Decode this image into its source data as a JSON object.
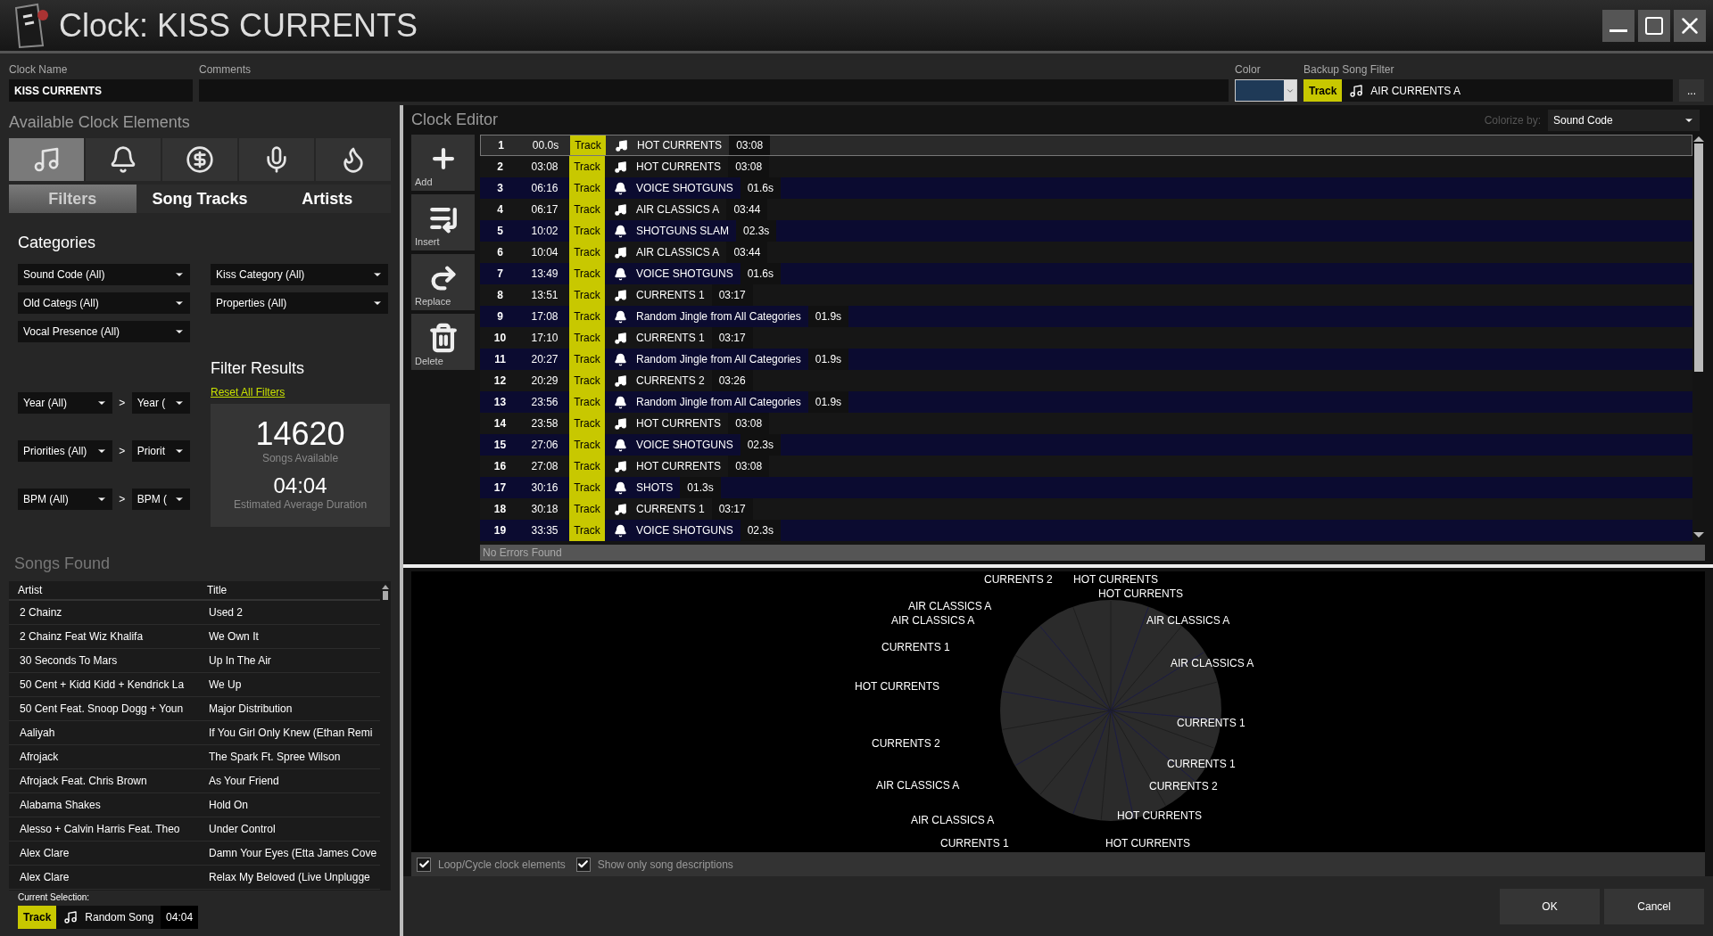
{
  "window": {
    "title": "Clock: KISS CURRENTS"
  },
  "clock_name": {
    "label": "Clock Name",
    "value": "KISS CURRENTS"
  },
  "comments": {
    "label": "Comments"
  },
  "color_picker": {
    "label": "Color",
    "color": "#1f3a57"
  },
  "backup_song_filter": {
    "label": "Backup Song Filter",
    "type": "Track",
    "value": "AIR CURRENTS A",
    "more": "..."
  },
  "available_elements": {
    "title": "Available Clock Elements",
    "element_buttons": [
      {
        "kind": "song",
        "selected": true
      },
      {
        "kind": "jingle",
        "selected": false
      },
      {
        "kind": "ad",
        "selected": false
      },
      {
        "kind": "voice",
        "selected": false
      },
      {
        "kind": "effect",
        "selected": false
      }
    ],
    "tabs": [
      {
        "label": "Filters",
        "selected": true
      },
      {
        "label": "Song Tracks",
        "selected": false
      },
      {
        "label": "Artists",
        "selected": false
      }
    ]
  },
  "categories": {
    "title": "Categories",
    "dropdowns": [
      "Sound Code (All)",
      "Kiss Category (All)",
      "Old Categs (All)",
      "Properties (All)",
      "Vocal Presence (All)"
    ]
  },
  "ranges": [
    {
      "from": "Year (All)",
      "separator": ">",
      "to": "Year ("
    },
    {
      "from": "Priorities (All)",
      "separator": ">",
      "to": "Priorit"
    },
    {
      "from": "BPM (All)",
      "separator": ">",
      "to": "BPM ("
    }
  ],
  "filter_results": {
    "title": "Filter Results",
    "reset": "Reset All Filters",
    "count": "14620",
    "count_label": "Songs Available",
    "duration": "04:04",
    "duration_label": "Estimated Average Duration"
  },
  "songs_found": {
    "title": "Songs Found",
    "columns": [
      "Artist",
      "Title"
    ],
    "rows": [
      [
        "2 Chainz",
        "Used 2"
      ],
      [
        "2 Chainz Feat Wiz Khalifa",
        "We Own It"
      ],
      [
        "30 Seconds To Mars",
        "Up In The Air"
      ],
      [
        "50 Cent + Kidd Kidd + Kendrick La",
        "We Up"
      ],
      [
        "50 Cent Feat. Snoop Dogg + Youn",
        "Major Distribution"
      ],
      [
        "Aaliyah",
        "If You Girl Only Knew (Ethan Remi"
      ],
      [
        "Afrojack",
        "The Spark Ft. Spree Wilson"
      ],
      [
        "Afrojack Feat. Chris Brown",
        "As Your Friend"
      ],
      [
        "Alabama Shakes",
        "Hold On"
      ],
      [
        "Alesso + Calvin Harris Feat. Theo",
        "Under Control"
      ],
      [
        "Alex Clare",
        "Damn Your Eyes (Etta James Cove"
      ],
      [
        "Alex Clare",
        "Relax My Beloved (Live Unplugge"
      ]
    ]
  },
  "current_selection": {
    "label": "Current Selection:",
    "type": "Track",
    "value": "Random Song",
    "duration": "04:04"
  },
  "clock_editor": {
    "title": "Clock Editor",
    "colorize_label": "Colorize by:",
    "colorize_value": "Sound Code",
    "actions": [
      {
        "kind": "add",
        "label": "Add"
      },
      {
        "kind": "insert",
        "label": "Insert"
      },
      {
        "kind": "replace",
        "label": "Replace"
      },
      {
        "kind": "delete",
        "label": "Delete"
      }
    ],
    "rows": [
      {
        "number": "1",
        "time": "00.0s",
        "type": "Track",
        "kind": "song",
        "name": "HOT CURRENTS",
        "duration": "03:08",
        "color": "#2a2a2a",
        "selected": true
      },
      {
        "number": "2",
        "time": "03:08",
        "type": "Track",
        "kind": "song",
        "name": "HOT CURRENTS",
        "duration": "03:08",
        "color": "#161616",
        "selected": false
      },
      {
        "number": "3",
        "time": "06:16",
        "type": "Track",
        "kind": "jingle",
        "name": "VOICE SHOTGUNS",
        "duration": "01.6s",
        "color": "#0b0b30",
        "selected": false
      },
      {
        "number": "4",
        "time": "06:17",
        "type": "Track",
        "kind": "song",
        "name": "AIR CLASSICS A",
        "duration": "03:44",
        "color": "#161616",
        "selected": false
      },
      {
        "number": "5",
        "time": "10:02",
        "type": "Track",
        "kind": "jingle",
        "name": "SHOTGUNS SLAM",
        "duration": "02.3s",
        "color": "#0b0b30",
        "selected": false
      },
      {
        "number": "6",
        "time": "10:04",
        "type": "Track",
        "kind": "song",
        "name": "AIR CLASSICS A",
        "duration": "03:44",
        "color": "#161616",
        "selected": false
      },
      {
        "number": "7",
        "time": "13:49",
        "type": "Track",
        "kind": "jingle",
        "name": "VOICE SHOTGUNS",
        "duration": "01.6s",
        "color": "#0b0b30",
        "selected": false
      },
      {
        "number": "8",
        "time": "13:51",
        "type": "Track",
        "kind": "song",
        "name": "CURRENTS 1",
        "duration": "03:17",
        "color": "#161616",
        "selected": false
      },
      {
        "number": "9",
        "time": "17:08",
        "type": "Track",
        "kind": "jingle",
        "name": "Random Jingle from All Categories",
        "duration": "01.9s",
        "color": "#0b0b30",
        "selected": false
      },
      {
        "number": "10",
        "time": "17:10",
        "type": "Track",
        "kind": "song",
        "name": "CURRENTS 1",
        "duration": "03:17",
        "color": "#161616",
        "selected": false
      },
      {
        "number": "11",
        "time": "20:27",
        "type": "Track",
        "kind": "jingle",
        "name": "Random Jingle from All Categories",
        "duration": "01.9s",
        "color": "#0b0b30",
        "selected": false
      },
      {
        "number": "12",
        "time": "20:29",
        "type": "Track",
        "kind": "song",
        "name": "CURRENTS 2",
        "duration": "03:26",
        "color": "#161616",
        "selected": false
      },
      {
        "number": "13",
        "time": "23:56",
        "type": "Track",
        "kind": "jingle",
        "name": "Random Jingle from All Categories",
        "duration": "01.9s",
        "color": "#0b0b30",
        "selected": false
      },
      {
        "number": "14",
        "time": "23:58",
        "type": "Track",
        "kind": "song",
        "name": "HOT CURRENTS",
        "duration": "03:08",
        "color": "#161616",
        "selected": false
      },
      {
        "number": "15",
        "time": "27:06",
        "type": "Track",
        "kind": "jingle",
        "name": "VOICE SHOTGUNS",
        "duration": "02.3s",
        "color": "#0b0b30",
        "selected": false
      },
      {
        "number": "16",
        "time": "27:08",
        "type": "Track",
        "kind": "song",
        "name": "HOT CURRENTS",
        "duration": "03:08",
        "color": "#161616",
        "selected": false
      },
      {
        "number": "17",
        "time": "30:16",
        "type": "Track",
        "kind": "jingle",
        "name": "SHOTS",
        "duration": "01.3s",
        "color": "#0b0b30",
        "selected": false
      },
      {
        "number": "18",
        "time": "30:18",
        "type": "Track",
        "kind": "song",
        "name": "CURRENTS 1",
        "duration": "03:17",
        "color": "#161616",
        "selected": false
      },
      {
        "number": "19",
        "time": "33:35",
        "type": "Track",
        "kind": "jingle",
        "name": "VOICE SHOTGUNS",
        "duration": "02.3s",
        "color": "#0b0b30",
        "selected": false
      }
    ],
    "status": "No Errors Found"
  },
  "pie": {
    "slice_labels": [
      "CURRENTS 2",
      "HOT CURRENTS",
      "HOT CURRENTS",
      "AIR CLASSICS A",
      "AIR CLASSICS A",
      "AIR CLASSICS A",
      "CURRENTS 1",
      "AIR CLASSICS A",
      "HOT CURRENTS",
      "CURRENTS 1",
      "CURRENTS 2",
      "CURRENTS 1",
      "CURRENTS 2",
      "AIR CLASSICS A",
      "HOT CURRENTS",
      "AIR CLASSICS A",
      "CURRENTS 1",
      "HOT CURRENTS"
    ]
  },
  "options": [
    {
      "label": "Loop/Cycle clock elements",
      "checked": true
    },
    {
      "label": "Show only song descriptions",
      "checked": true
    }
  ],
  "buttons": [
    "OK",
    "Cancel"
  ]
}
